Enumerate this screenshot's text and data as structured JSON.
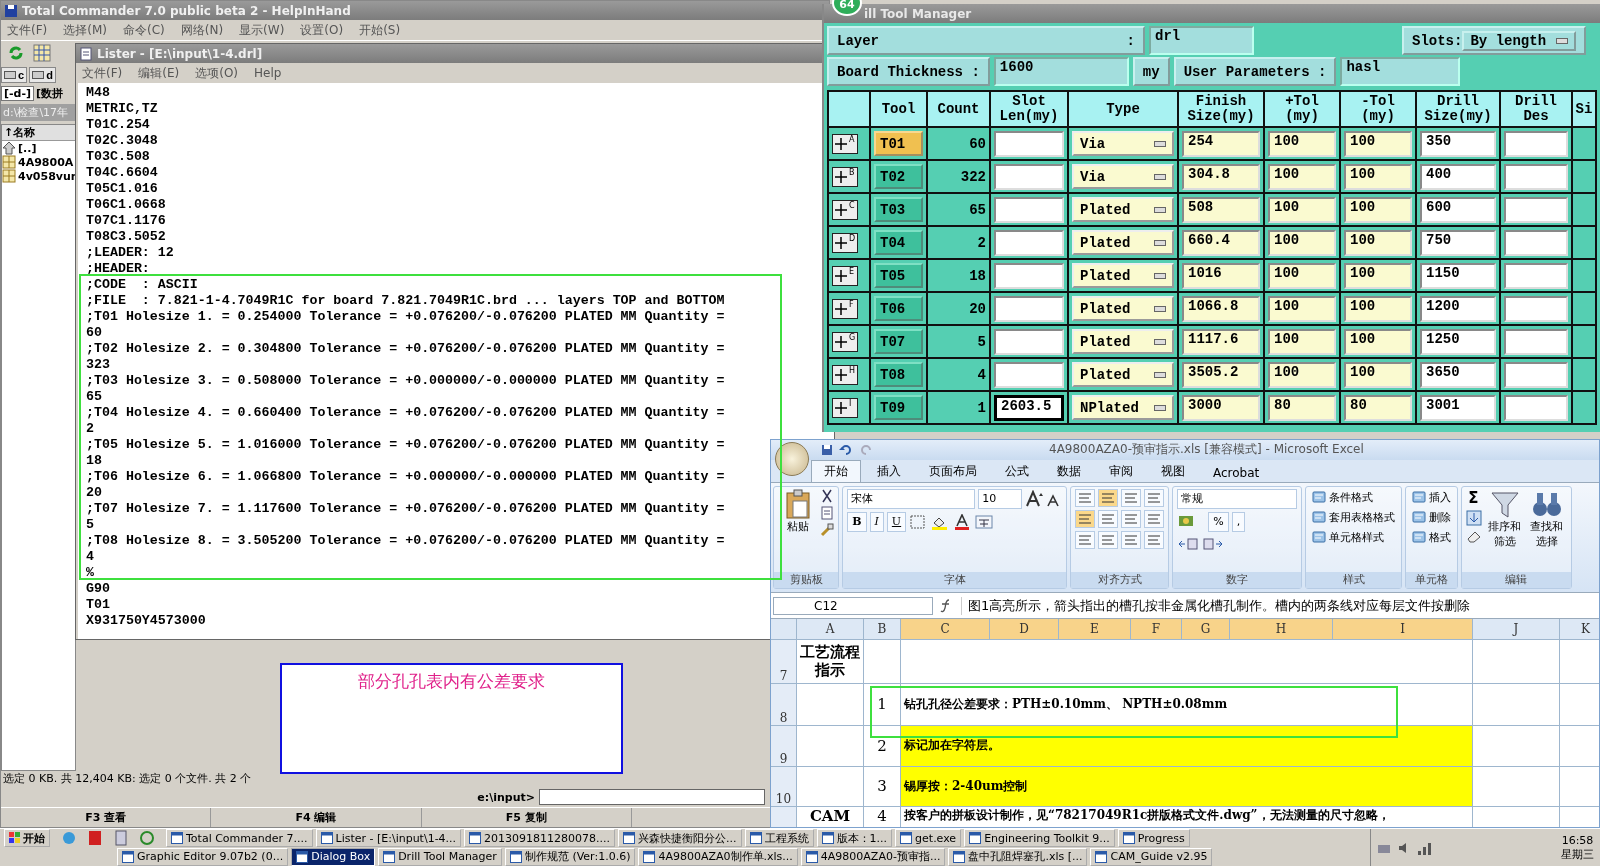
{
  "total_commander": {
    "title": "Total Commander 7.0 public beta 2 - HelpInHand",
    "menu": [
      "文件(F)",
      "选择(M)",
      "命令(C)",
      "网络(N)",
      "显示(W)",
      "设置(O)",
      "开始(S)"
    ],
    "drives": [
      "c",
      "d"
    ],
    "drive_select": "[-d-]",
    "drive_label": "[数拼",
    "path": "d:\\检查\\17年",
    "sort_header": "↑名称",
    "files": [
      {
        "name": "[..]",
        "kind": "up"
      },
      {
        "name": "4A9800A",
        "kind": "archive"
      },
      {
        "name": "4v058vur",
        "kind": "archive"
      }
    ],
    "status": "选定 0 KB. 共 12,404 KB: 选定 0 个文件. 共 2 个",
    "command_prompt": "e:\\input>",
    "function_keys": [
      "F3 查看",
      "F4 编辑",
      "F5 复制"
    ]
  },
  "lister": {
    "title": "Lister - [E:\\input\\1-4.drl]",
    "menu": [
      "文件(F)",
      "编辑(E)",
      "选项(O)",
      "Help"
    ],
    "lines": [
      "M48",
      "METRIC,TZ",
      "T01C.254",
      "T02C.3048",
      "T03C.508",
      "T04C.6604",
      "T05C1.016",
      "T06C1.0668",
      "T07C1.1176",
      "T08C3.5052",
      ";LEADER: 12",
      ";HEADER:",
      ";CODE  : ASCII",
      ";FILE  : 7.821-1-4.7049R1C for board 7.821.7049R1C.brd ... layers TOP and BOTTOM",
      ";T01 Holesize 1. = 0.254000 Tolerance = +0.076200/-0.076200 PLATED MM Quantity =",
      "60",
      ";T02 Holesize 2. = 0.304800 Tolerance = +0.076200/-0.076200 PLATED MM Quantity =",
      "323",
      ";T03 Holesize 3. = 0.508000 Tolerance = +0.000000/-0.000000 PLATED MM Quantity =",
      "65",
      ";T04 Holesize 4. = 0.660400 Tolerance = +0.076200/-0.076200 PLATED MM Quantity =",
      "2",
      ";T05 Holesize 5. = 1.016000 Tolerance = +0.076200/-0.076200 PLATED MM Quantity =",
      "18",
      ";T06 Holesize 6. = 1.066800 Tolerance = +0.000000/-0.000000 PLATED MM Quantity =",
      "20",
      ";T07 Holesize 7. = 1.117600 Tolerance = +0.076200/-0.076200 PLATED MM Quantity =",
      "5",
      ";T08 Holesize 8. = 3.505200 Tolerance = +0.076200/-0.076200 PLATED MM Quantity =",
      "4",
      "%",
      "G90",
      "T01",
      "X931750Y4573000"
    ]
  },
  "drill_tool_manager": {
    "badge": "64",
    "title": "ill Tool Manager",
    "layer_label": "Layer",
    "layer_colon": ":",
    "layer_value": "drl",
    "slots_label": "Slots:",
    "slots_value": "By length",
    "thickness_label": "Board Thickness :",
    "thickness_value": "1600",
    "thickness_unit": "my",
    "user_params_label": "User Parameters :",
    "user_params_value": "hasl",
    "columns": [
      "Tool",
      "Count",
      "Slot Len(my)",
      "Type",
      "Finish Size(my)",
      "+Tol (my)",
      "-Tol (my)",
      "Drill Size(my)",
      "Drill Des",
      "Si"
    ],
    "rows": [
      {
        "letter": "A",
        "tool": "T01",
        "selected": true,
        "count": "60",
        "type": "Via",
        "finish": "254",
        "plus_tol": "100",
        "minus_tol": "100",
        "drill": "350"
      },
      {
        "letter": "B",
        "tool": "T02",
        "selected": false,
        "count": "322",
        "type": "Via",
        "finish": "304.8",
        "plus_tol": "100",
        "minus_tol": "100",
        "drill": "400"
      },
      {
        "letter": "C",
        "tool": "T03",
        "selected": false,
        "count": "65",
        "type": "Plated",
        "finish": "508",
        "plus_tol": "100",
        "minus_tol": "100",
        "drill": "600"
      },
      {
        "letter": "D",
        "tool": "T04",
        "selected": false,
        "count": "2",
        "type": "Plated",
        "finish": "660.4",
        "plus_tol": "100",
        "minus_tol": "100",
        "drill": "750"
      },
      {
        "letter": "E",
        "tool": "T05",
        "selected": false,
        "count": "18",
        "type": "Plated",
        "finish": "1016",
        "plus_tol": "100",
        "minus_tol": "100",
        "drill": "1150"
      },
      {
        "letter": "F",
        "tool": "T06",
        "selected": false,
        "count": "20",
        "type": "Plated",
        "finish": "1066.8",
        "plus_tol": "100",
        "minus_tol": "100",
        "drill": "1200"
      },
      {
        "letter": "G",
        "tool": "T07",
        "selected": false,
        "count": "5",
        "type": "Plated",
        "finish": "1117.6",
        "plus_tol": "100",
        "minus_tol": "100",
        "drill": "1250"
      },
      {
        "letter": "H",
        "tool": "T08",
        "selected": false,
        "count": "4",
        "type": "Plated",
        "finish": "3505.2",
        "plus_tol": "100",
        "minus_tol": "100",
        "drill": "3650"
      },
      {
        "letter": "I",
        "tool": "T09",
        "selected": false,
        "count": "1",
        "slot_len": "2603.5",
        "type": "NPlated",
        "finish": "3000",
        "plus_tol": "80",
        "minus_tol": "80",
        "drill": "3001"
      }
    ]
  },
  "excel": {
    "title": "4A9800AZA0-预审指示.xls  [兼容模式] - Microsoft Excel",
    "tabs": [
      {
        "label": "开始",
        "selected": true
      },
      {
        "label": "插入",
        "selected": false
      },
      {
        "label": "页面布局",
        "selected": false
      },
      {
        "label": "公式",
        "selected": false
      },
      {
        "label": "数据",
        "selected": false
      },
      {
        "label": "审阅",
        "selected": false
      },
      {
        "label": "视图",
        "selected": false
      },
      {
        "label": "Acrobat",
        "selected": false
      }
    ],
    "groups": [
      {
        "kind": "clipboard",
        "label": "剪贴板",
        "items": [
          "粘贴"
        ]
      },
      {
        "kind": "font",
        "label": "字体",
        "items": [
          "宋体",
          "10",
          "B",
          "I",
          "U"
        ]
      },
      {
        "kind": "alignment",
        "label": "对齐方式"
      },
      {
        "kind": "number",
        "label": "数字",
        "items": [
          "常规",
          "%",
          ","
        ]
      },
      {
        "kind": "list",
        "label": "样式",
        "items": [
          "条件格式",
          "套用表格格式",
          "单元格样式"
        ]
      },
      {
        "kind": "list",
        "label": "单元格",
        "items": [
          "插入",
          "删除",
          "格式"
        ]
      },
      {
        "kind": "editing",
        "label": "编辑",
        "items": [
          "Σ",
          "排序和筛选",
          "查找和选择"
        ]
      }
    ],
    "name_box": "C12",
    "formula": "图1高亮所示，箭头指出的槽孔按非金属化槽孔制作。槽内的两条线对应每层文件按删除",
    "columns": [
      "A",
      "B",
      "C",
      "D",
      "E",
      "F",
      "G",
      "H",
      "I",
      "J",
      "K"
    ],
    "rows": [
      {
        "number": "7",
        "a": "工艺流程指示",
        "highlight": false
      },
      {
        "number": "8",
        "b": "1",
        "c": "钻孔孔径公差要求：PTH±0.10mm、 NPTH±0.08mm",
        "highlight": false
      },
      {
        "number": "9",
        "b": "2",
        "c": "标记加在字符层。",
        "highlight": true
      },
      {
        "number": "10",
        "b": "3",
        "c": "锡厚按：2-40um控制",
        "highlight": true
      },
      {
        "a": "CAM",
        "b": "4",
        "c": "按客户的拼板设计制作，见“78217049R1c拼版格式文件.dwg”，无法测量的尺寸忽略，",
        "highlight": false
      }
    ]
  },
  "annotation": "部分孔孔表内有公差要求",
  "taskbar": {
    "start": "开始",
    "row_1": [
      {
        "label": "Total Commander 7....",
        "selected": false
      },
      {
        "label": "Lister - [E:\\input\\1-4...",
        "selected": false
      },
      {
        "label": "2013091811280078....",
        "selected": false
      },
      {
        "label": "兴森快捷衡阳分公...",
        "selected": false
      },
      {
        "label": "工程系统",
        "selected": false
      },
      {
        "label": "版本：1...",
        "selected": false
      },
      {
        "label": "get.exe",
        "selected": false
      },
      {
        "label": "Engineering Toolkit 9...",
        "selected": false
      },
      {
        "label": "Progress",
        "selected": false
      }
    ],
    "row_2": [
      {
        "label": "Graphic Editor 9.07b2 (0...",
        "selected": false
      },
      {
        "label": "Dialog Box",
        "selected": true
      },
      {
        "label": "Drill Tool Manager",
        "selected": false
      },
      {
        "label": "制作规范 (Ver:1.0.6)",
        "selected": false
      },
      {
        "label": "4A9800AZA0制作单.xls...",
        "selected": false
      },
      {
        "label": "4A9800AZA0-预审指...",
        "selected": false
      },
      {
        "label": "盘中孔阻焊塞孔.xls [...",
        "selected": false
      },
      {
        "label": "CAM_Guide v2.95",
        "selected": false
      }
    ],
    "clock": "16:58",
    "day": "星期三"
  }
}
